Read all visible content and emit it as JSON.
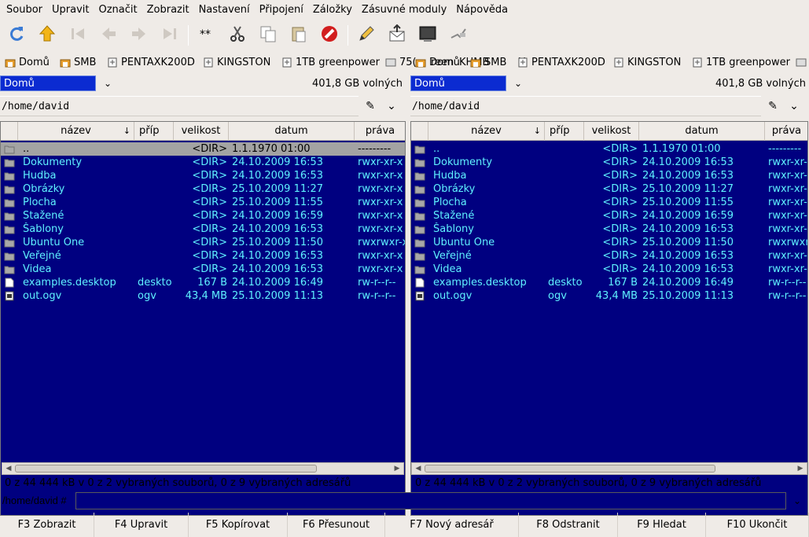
{
  "menu": [
    "Soubor",
    "Upravit",
    "Označit",
    "Zobrazit",
    "Nastavení",
    "Připojení",
    "Záložky",
    "Zásuvné moduly",
    "Nápověda"
  ],
  "toolbar": [
    {
      "icon": "refresh-icon",
      "enabled": true
    },
    {
      "icon": "home-up-icon",
      "enabled": true
    },
    {
      "icon": "first-icon",
      "enabled": false
    },
    {
      "icon": "back-icon",
      "enabled": false
    },
    {
      "icon": "forward-icon",
      "enabled": false
    },
    {
      "icon": "last-icon",
      "enabled": false
    },
    {
      "icon": "select-all-icon",
      "enabled": true
    },
    {
      "icon": "cut-icon",
      "enabled": true
    },
    {
      "icon": "copy-icon",
      "enabled": true
    },
    {
      "icon": "paste-icon",
      "enabled": true
    },
    {
      "icon": "stop-icon",
      "enabled": true
    },
    {
      "icon": "edit-icon",
      "enabled": true
    },
    {
      "icon": "mail-icon",
      "enabled": true
    },
    {
      "icon": "terminal-icon",
      "enabled": true
    },
    {
      "icon": "connect-icon",
      "enabled": true
    }
  ],
  "bookmarks_left": [
    "Domů",
    "SMB",
    "PENTAXK200D",
    "KINGSTON",
    "1TB greenpower",
    "75("
  ],
  "bookmarks_right": [
    "Domů",
    "SMB",
    "PENTAXK200D",
    "KINGSTON",
    "1TB greenpower"
  ],
  "bookmarks_overlap": [
    "reen",
    "KHMB",
    "Y"
  ],
  "columns": [
    "název",
    "příp",
    "velikost",
    "datum",
    "práva"
  ],
  "sort_indicator": "↓",
  "left": {
    "drive": "Domů",
    "free": "401,8 GB volných",
    "path": "/home/david",
    "status": "0  z 44 444  kB v 0 z 2 vybraných souborů, 0 z 9 vybraných adresářů"
  },
  "right": {
    "drive": "Domů",
    "free": "401,8 GB volných",
    "path": "/home/david",
    "status": "0  z 44 444  kB v 0 z 2 vybraných souborů, 0 z 9 vybraných adresářů"
  },
  "files": [
    {
      "name": "..",
      "ext": "",
      "size": "<DIR>",
      "date": "1.1.1970 01:00",
      "perm": "---------",
      "type": "dir"
    },
    {
      "name": "Dokumenty",
      "ext": "",
      "size": "<DIR>",
      "date": "24.10.2009 16:53",
      "perm": "rwxr-xr-x",
      "type": "dir"
    },
    {
      "name": "Hudba",
      "ext": "",
      "size": "<DIR>",
      "date": "24.10.2009 16:53",
      "perm": "rwxr-xr-x",
      "type": "dir"
    },
    {
      "name": "Obrázky",
      "ext": "",
      "size": "<DIR>",
      "date": "25.10.2009 11:27",
      "perm": "rwxr-xr-x",
      "type": "dir"
    },
    {
      "name": "Plocha",
      "ext": "",
      "size": "<DIR>",
      "date": "25.10.2009 11:55",
      "perm": "rwxr-xr-x",
      "type": "dir"
    },
    {
      "name": "Stažené",
      "ext": "",
      "size": "<DIR>",
      "date": "24.10.2009 16:59",
      "perm": "rwxr-xr-x",
      "type": "dir"
    },
    {
      "name": "Šablony",
      "ext": "",
      "size": "<DIR>",
      "date": "24.10.2009 16:53",
      "perm": "rwxr-xr-x",
      "type": "dir"
    },
    {
      "name": "Ubuntu One",
      "ext": "",
      "size": "<DIR>",
      "date": "25.10.2009 11:50",
      "perm": "rwxrwxr-x",
      "type": "dir"
    },
    {
      "name": "Veřejné",
      "ext": "",
      "size": "<DIR>",
      "date": "24.10.2009 16:53",
      "perm": "rwxr-xr-x",
      "type": "dir"
    },
    {
      "name": "Videa",
      "ext": "",
      "size": "<DIR>",
      "date": "24.10.2009 16:53",
      "perm": "rwxr-xr-x",
      "type": "dir"
    },
    {
      "name": "examples.desktop",
      "ext": "desktop",
      "size": "167 B",
      "date": "24.10.2009 16:49",
      "perm": "rw-r--r--",
      "type": "file"
    },
    {
      "name": "out.ogv",
      "ext": "ogv",
      "size": "43,4 MB",
      "date": "25.10.2009 11:13",
      "perm": "rw-r--r--",
      "type": "media"
    }
  ],
  "cmd": {
    "label": "/home/david #",
    "value": ""
  },
  "fkeys": [
    "F3 Zobrazit",
    "F4 Upravit",
    "F5 Kopírovat",
    "F6 Přesunout",
    "F7 Nový adresář",
    "F8 Odstranit",
    "F9 Hledat",
    "F10 Ukončit"
  ],
  "colors": {
    "panel_bg": "#000080",
    "file_text": "#5ff2ff",
    "selected_row": "#a3a3a3",
    "drive_select": "#0b2bd1"
  }
}
